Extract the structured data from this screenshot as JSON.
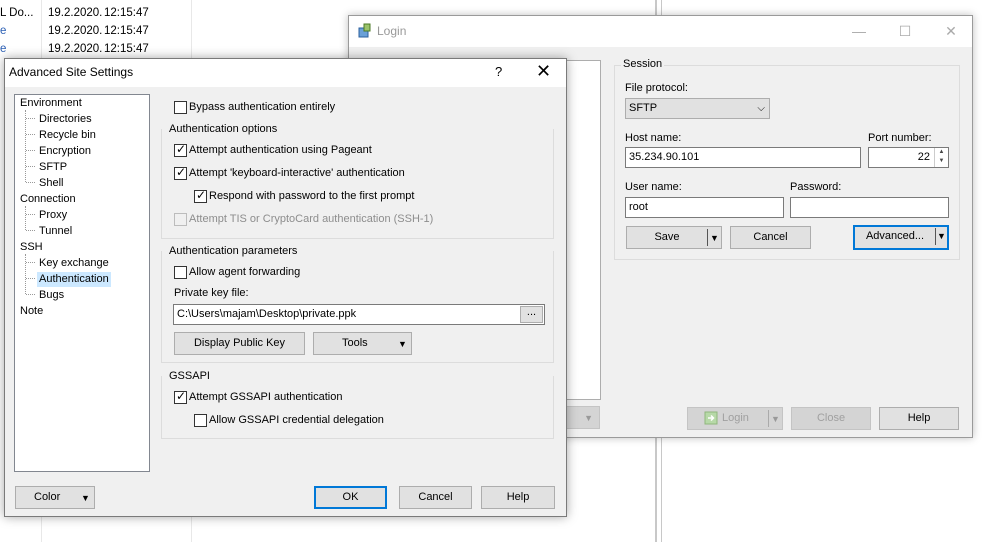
{
  "file_list": {
    "rows": [
      {
        "name": "L Do...",
        "date": "19.2.2020.",
        "time": "12:15:47"
      },
      {
        "name": "e",
        "date": "19.2.2020.",
        "time": "12:15:47"
      },
      {
        "name": "e",
        "date": "19.2.2020.",
        "time": "12:15:47"
      }
    ]
  },
  "login": {
    "title": "Login",
    "session_label": "Session",
    "file_protocol_label": "File protocol:",
    "file_protocol_value": "SFTP",
    "host_name_label": "Host name:",
    "host_name_value": "35.234.90.101",
    "port_label": "Port number:",
    "port_value": "22",
    "user_name_label": "User name:",
    "user_name_value": "root",
    "password_label": "Password:",
    "password_value": "",
    "save_label": "Save",
    "cancel_label": "Cancel",
    "advanced_label": "Advanced...",
    "login_label": "Login",
    "close_label": "Close",
    "help_label": "Help"
  },
  "advanced": {
    "title": "Advanced Site Settings",
    "help_glyph": "?",
    "close_glyph": "✕",
    "tree": [
      {
        "label": "Environment",
        "level": 0
      },
      {
        "label": "Directories",
        "level": 1
      },
      {
        "label": "Recycle bin",
        "level": 1
      },
      {
        "label": "Encryption",
        "level": 1
      },
      {
        "label": "SFTP",
        "level": 1
      },
      {
        "label": "Shell",
        "level": 1
      },
      {
        "label": "Connection",
        "level": 0
      },
      {
        "label": "Proxy",
        "level": 1
      },
      {
        "label": "Tunnel",
        "level": 1
      },
      {
        "label": "SSH",
        "level": 0
      },
      {
        "label": "Key exchange",
        "level": 1
      },
      {
        "label": "Authentication",
        "level": 1,
        "selected": true
      },
      {
        "label": "Bugs",
        "level": 1
      },
      {
        "label": "Note",
        "level": 0
      }
    ],
    "bypass_label": "Bypass authentication entirely",
    "bypass_checked": false,
    "auth_options_label": "Authentication options",
    "pageant_label": "Attempt authentication using Pageant",
    "pageant_checked": true,
    "kbd_label": "Attempt 'keyboard-interactive' authentication",
    "kbd_checked": true,
    "respond_label": "Respond with password to the first prompt",
    "respond_checked": true,
    "tis_label": "Attempt TIS or CryptoCard authentication (SSH-1)",
    "tis_checked": false,
    "auth_params_label": "Authentication parameters",
    "agent_fwd_label": "Allow agent forwarding",
    "agent_fwd_checked": false,
    "private_key_label": "Private key file:",
    "private_key_value": "C:\\Users\\majam\\Desktop\\private.ppk",
    "browse_label": "...",
    "display_key_label": "Display Public Key",
    "tools_label": "Tools",
    "gssapi_label": "GSSAPI",
    "gssapi_attempt_label": "Attempt GSSAPI authentication",
    "gssapi_attempt_checked": true,
    "gssapi_deleg_label": "Allow GSSAPI credential delegation",
    "gssapi_deleg_checked": false,
    "color_label": "Color",
    "ok_label": "OK",
    "cancel_label": "Cancel",
    "help_label": "Help"
  },
  "icons": {
    "dropdown": "▼",
    "combo_chevron": "⌵",
    "spin_up": "▲",
    "spin_down": "▼",
    "minimize": "—",
    "maximize": "☐",
    "close": "✕"
  }
}
